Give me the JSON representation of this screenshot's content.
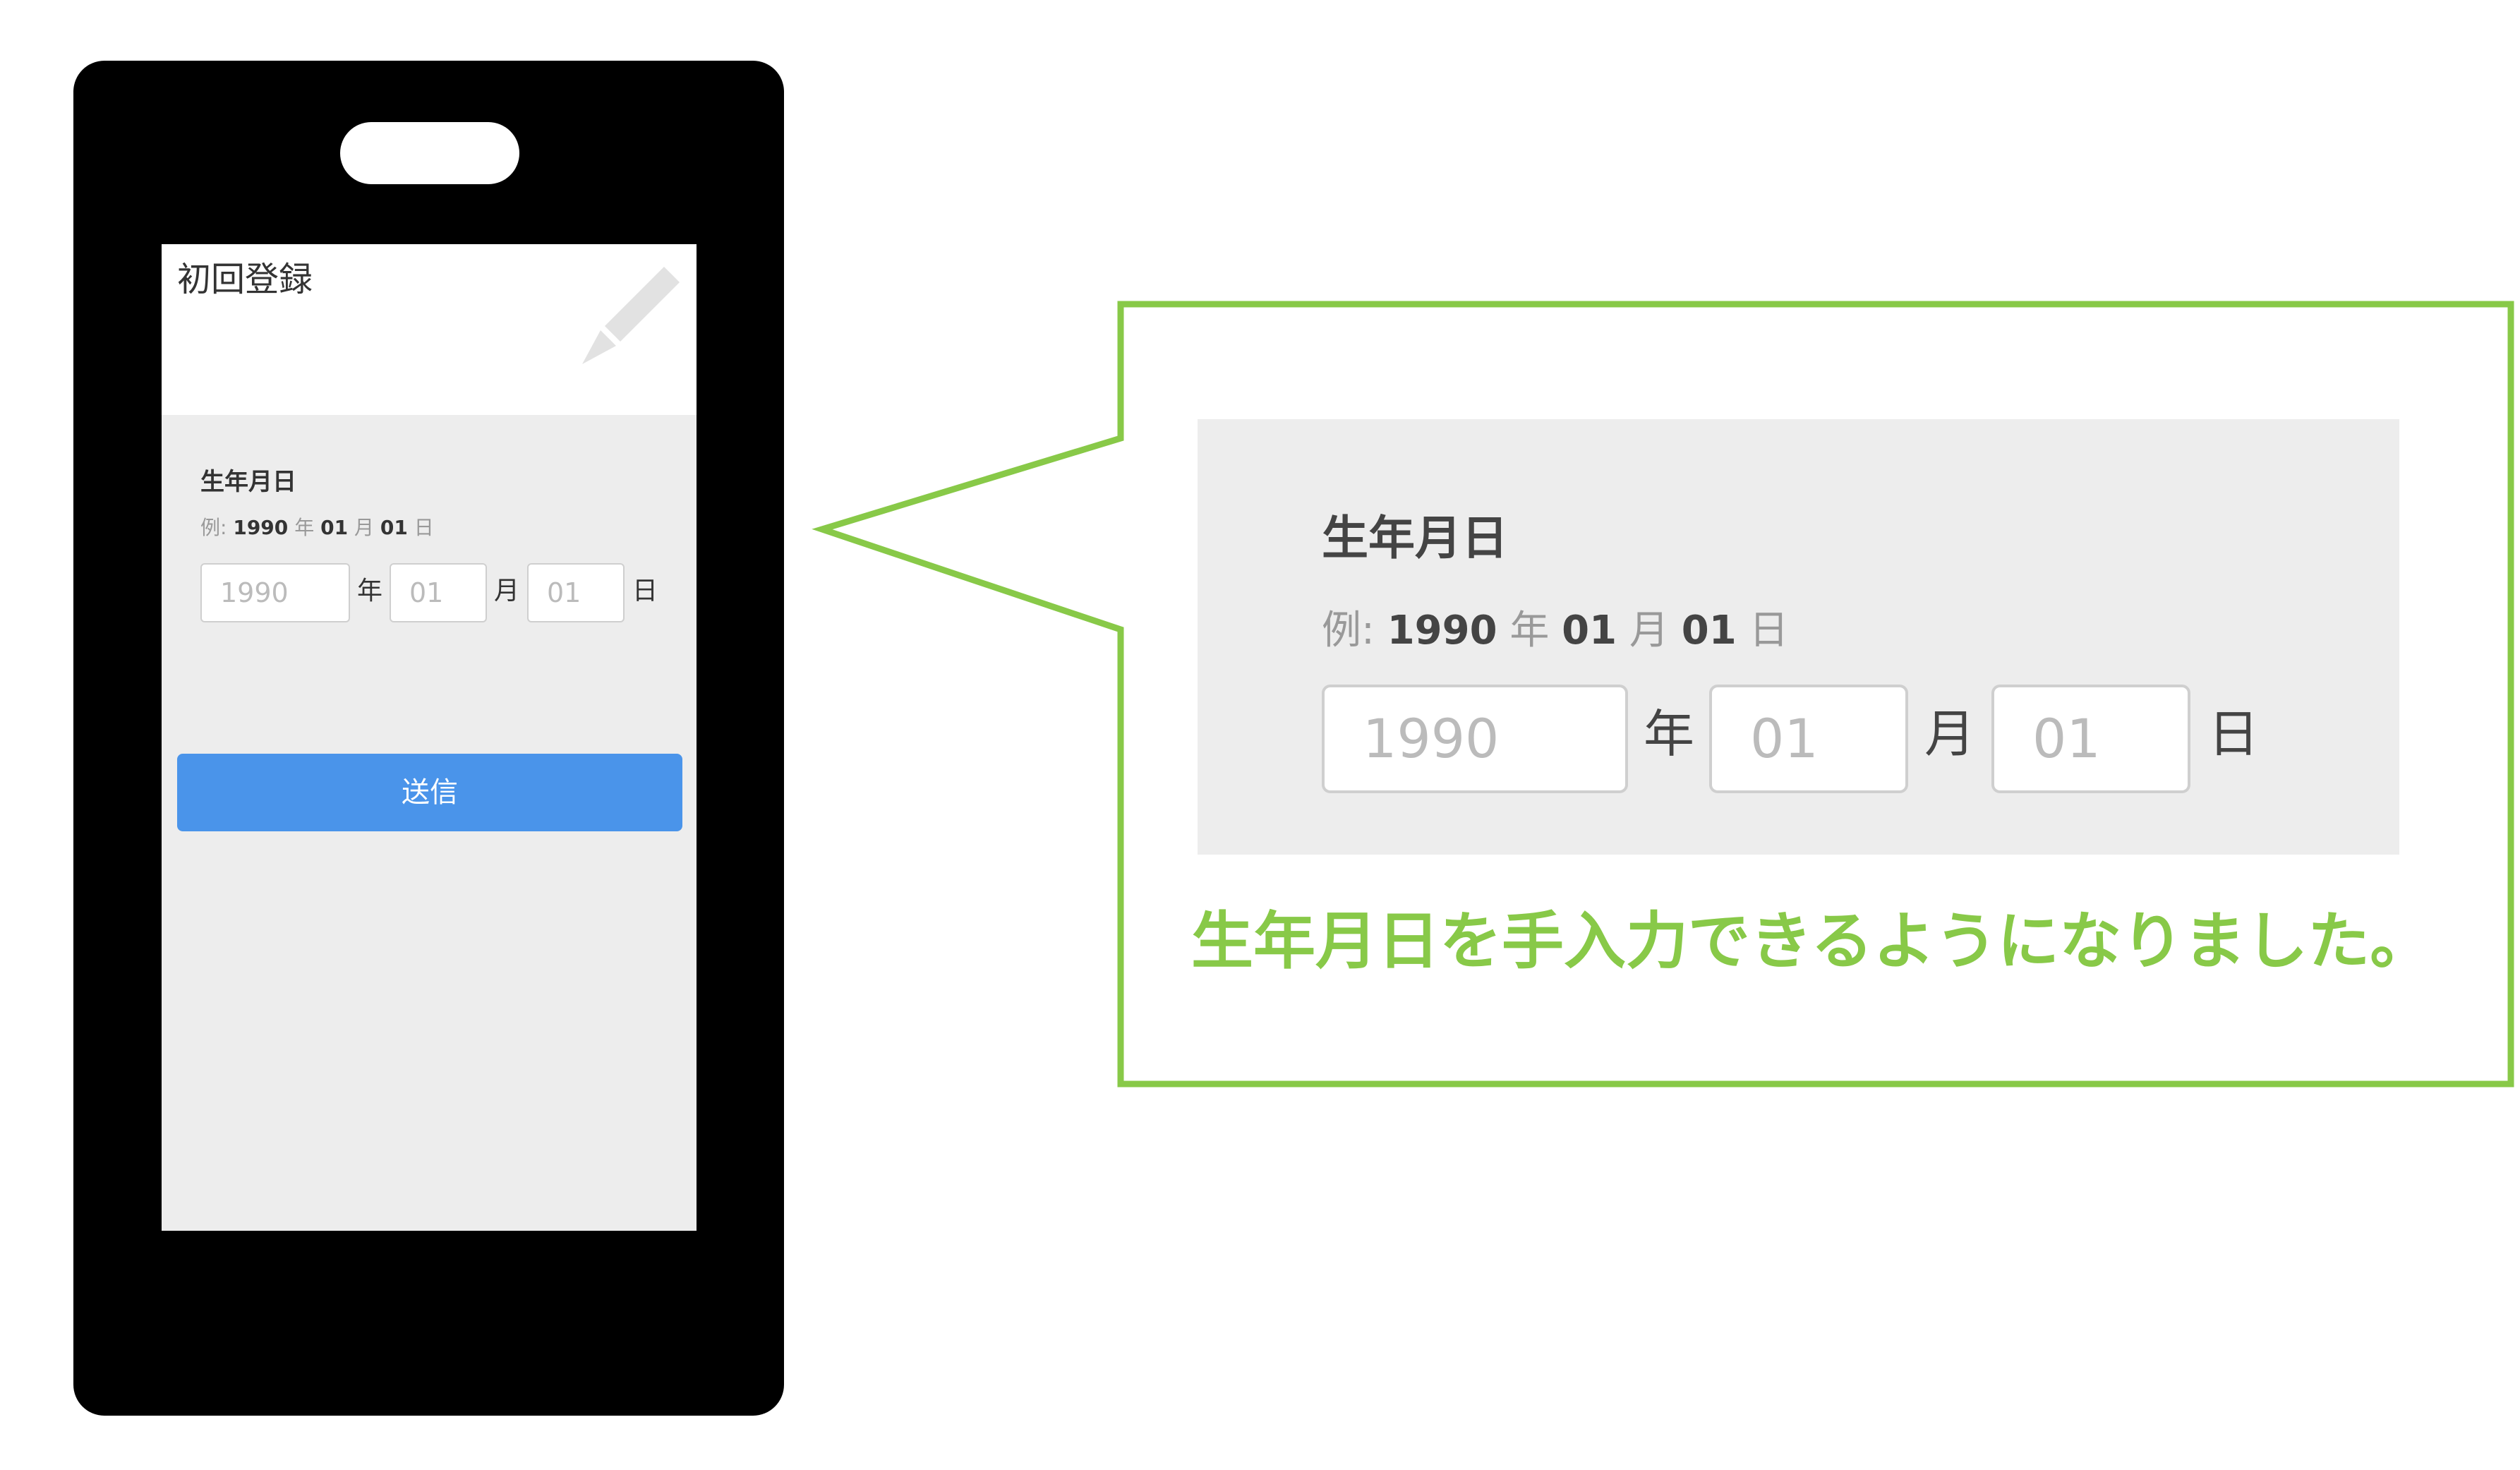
{
  "colors": {
    "accent_green": "#88c948",
    "submit_blue": "#4a94ea",
    "panel_gray": "#ededed",
    "phone_black": "#000000"
  },
  "phone": {
    "screen_title": "初回登録",
    "header_icon": "pencil-icon",
    "birthday": {
      "label": "生年月日",
      "example_prefix": "例:",
      "example_year": "1990",
      "example_year_unit": "年",
      "example_month": "01",
      "example_month_unit": "月",
      "example_day": "01",
      "example_day_unit": "日",
      "year_placeholder": "1990",
      "year_unit": "年",
      "month_placeholder": "01",
      "month_unit": "月",
      "day_placeholder": "01",
      "day_unit": "日"
    },
    "submit_label": "送信"
  },
  "callout": {
    "birthday": {
      "label": "生年月日",
      "example_prefix": "例:",
      "example_year": "1990",
      "example_year_unit": "年",
      "example_month": "01",
      "example_month_unit": "月",
      "example_day": "01",
      "example_day_unit": "日",
      "year_placeholder": "1990",
      "year_unit": "年",
      "month_placeholder": "01",
      "month_unit": "月",
      "day_placeholder": "01",
      "day_unit": "日"
    },
    "caption": "生年月日を手入力できるようになりました。"
  }
}
